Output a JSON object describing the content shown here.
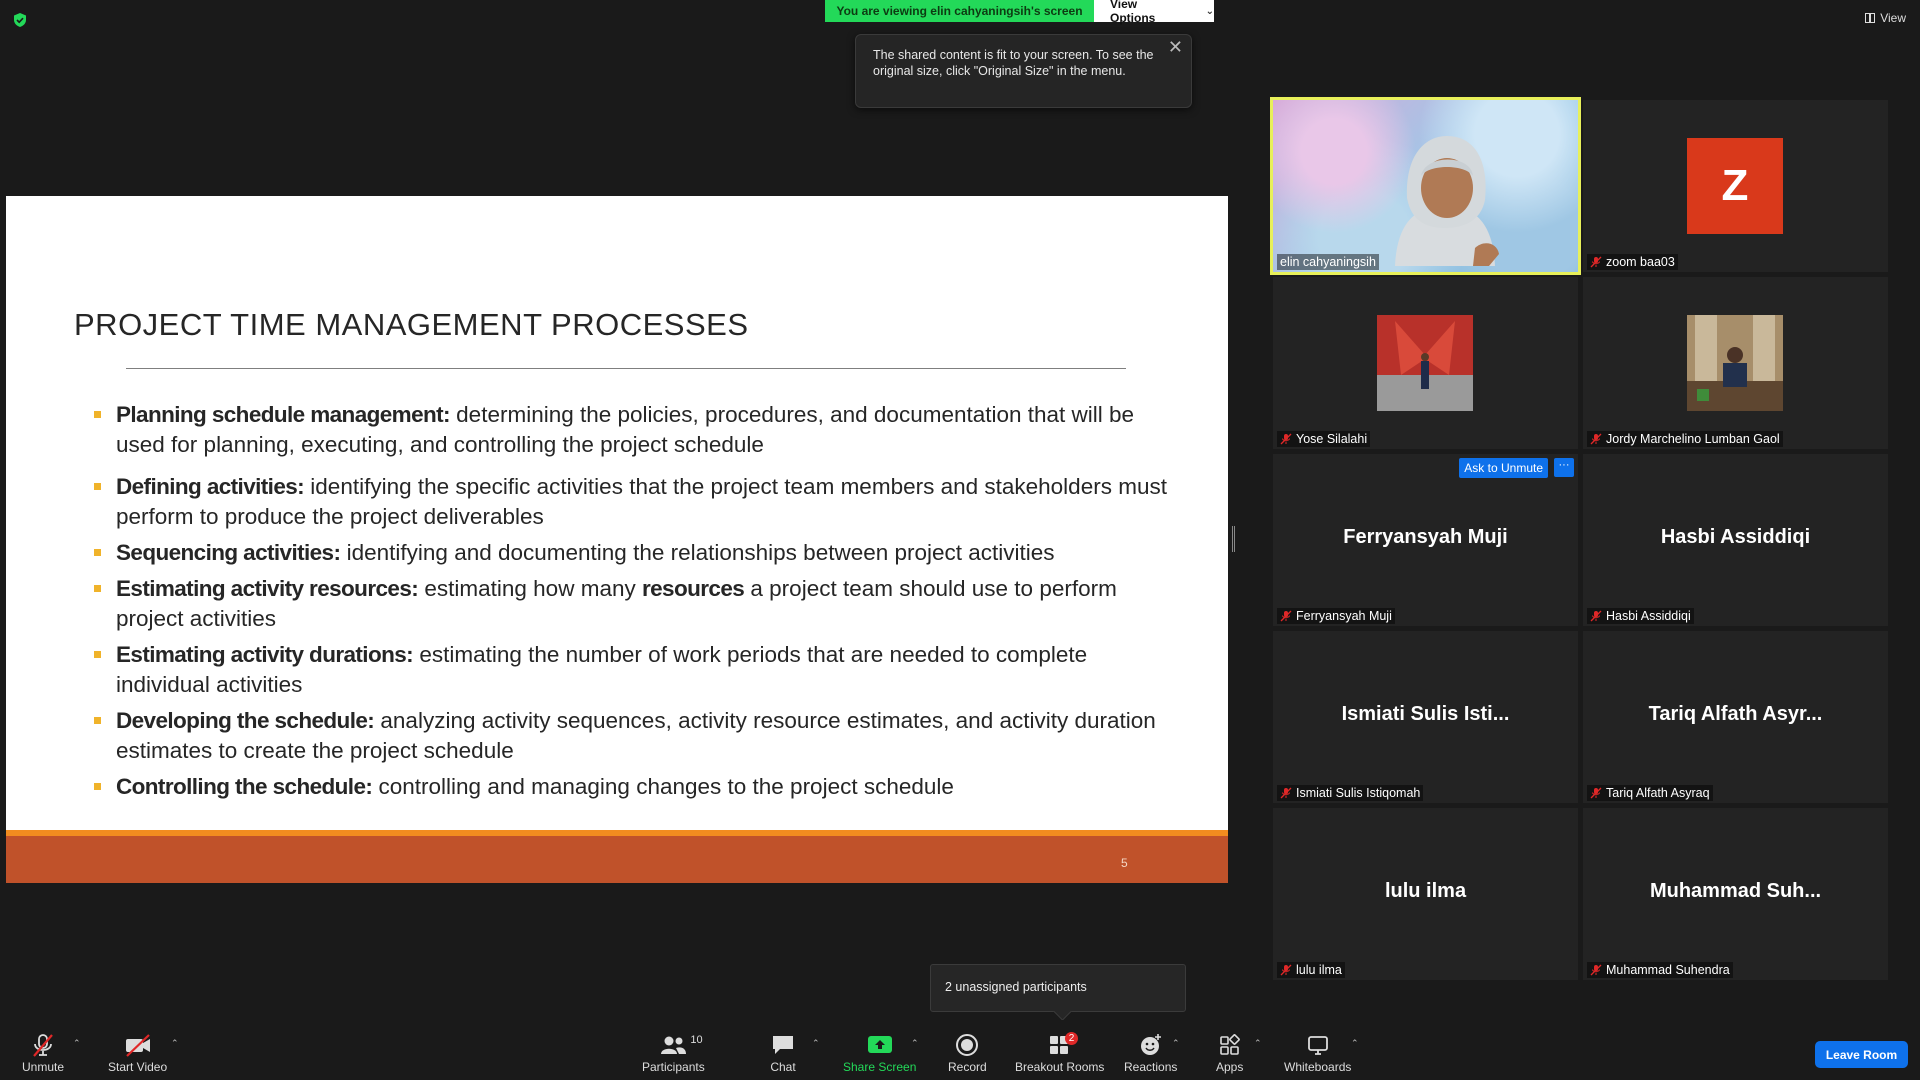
{
  "top": {
    "viewing_banner": "You are viewing elin cahyaningsih's screen",
    "view_options": "View Options",
    "tooltip_text": "The shared content is fit to your screen. To see the original size, click \"Original Size\" in the menu.",
    "view_label": "View"
  },
  "slide": {
    "title": "PROJECT TIME MANAGEMENT PROCESSES",
    "page_number": "5",
    "bullets": [
      {
        "term": "Planning schedule management:",
        "text": " determining the policies, procedures, and documentation that will be used for planning, executing, and controlling the project schedule"
      },
      {
        "term": "Defining activities:",
        "text": " identifying the specific activities that the project team members and stakeholders must perform to produce the project deliverables"
      },
      {
        "term": "Sequencing activities:",
        "text": " identifying and documenting the relationships between project activities"
      },
      {
        "term": "Estimating activity resources:",
        "text": " estimating how many ",
        "term2": "resources",
        "text2": " a project team should use to perform project activities"
      },
      {
        "term": "Estimating activity durations:",
        "text": " estimating the number of work periods that are needed to complete individual activities"
      },
      {
        "term": "Developing the schedule:",
        "text": " analyzing activity sequences, activity resource estimates, and activity duration estimates to create the project schedule"
      },
      {
        "term": "Controlling the schedule:",
        "text": " controlling and managing changes to the project schedule"
      }
    ]
  },
  "gallery": {
    "tiles": [
      {
        "name": "elin cahyaningsih",
        "big_name": ""
      },
      {
        "name": "zoom baa03",
        "big_name": "",
        "avatar_letter": "Z"
      },
      {
        "name": "Yose Silalahi",
        "big_name": ""
      },
      {
        "name": "Jordy Marchelino Lumban Gaol",
        "big_name": ""
      },
      {
        "name": "Ferryansyah Muji",
        "big_name": "Ferryansyah Muji"
      },
      {
        "name": "Hasbi Assiddiqi",
        "big_name": "Hasbi Assiddiqi"
      },
      {
        "name": "Ismiati Sulis Istiqomah",
        "big_name": "Ismiati Sulis Isti..."
      },
      {
        "name": "Tariq Alfath Asyraq",
        "big_name": "Tariq Alfath Asyr..."
      },
      {
        "name": "lulu ilma",
        "big_name": "lulu ilma"
      },
      {
        "name": "Muhammad Suhendra",
        "big_name": "Muhammad Suh..."
      }
    ],
    "ask_to_unmute": "Ask to Unmute",
    "more": "···"
  },
  "breakout_tip": "2 unassigned participants",
  "toolbar": {
    "unmute": "Unmute",
    "start_video": "Start Video",
    "participants": "Participants",
    "participants_count": "10",
    "chat": "Chat",
    "share_screen": "Share Screen",
    "record": "Record",
    "breakout_rooms": "Breakout Rooms",
    "breakout_badge": "2",
    "reactions": "Reactions",
    "apps": "Apps",
    "whiteboards": "Whiteboards",
    "leave": "Leave Room"
  },
  "colors": {
    "share_green": "#23d959",
    "zoom_blue": "#0e71eb",
    "slide_footer": "#c0522a",
    "slide_accent": "#f28c1f",
    "bullet": "#f0b32a",
    "avatar_z": "#d9391b",
    "mute_red": "#e02828"
  }
}
